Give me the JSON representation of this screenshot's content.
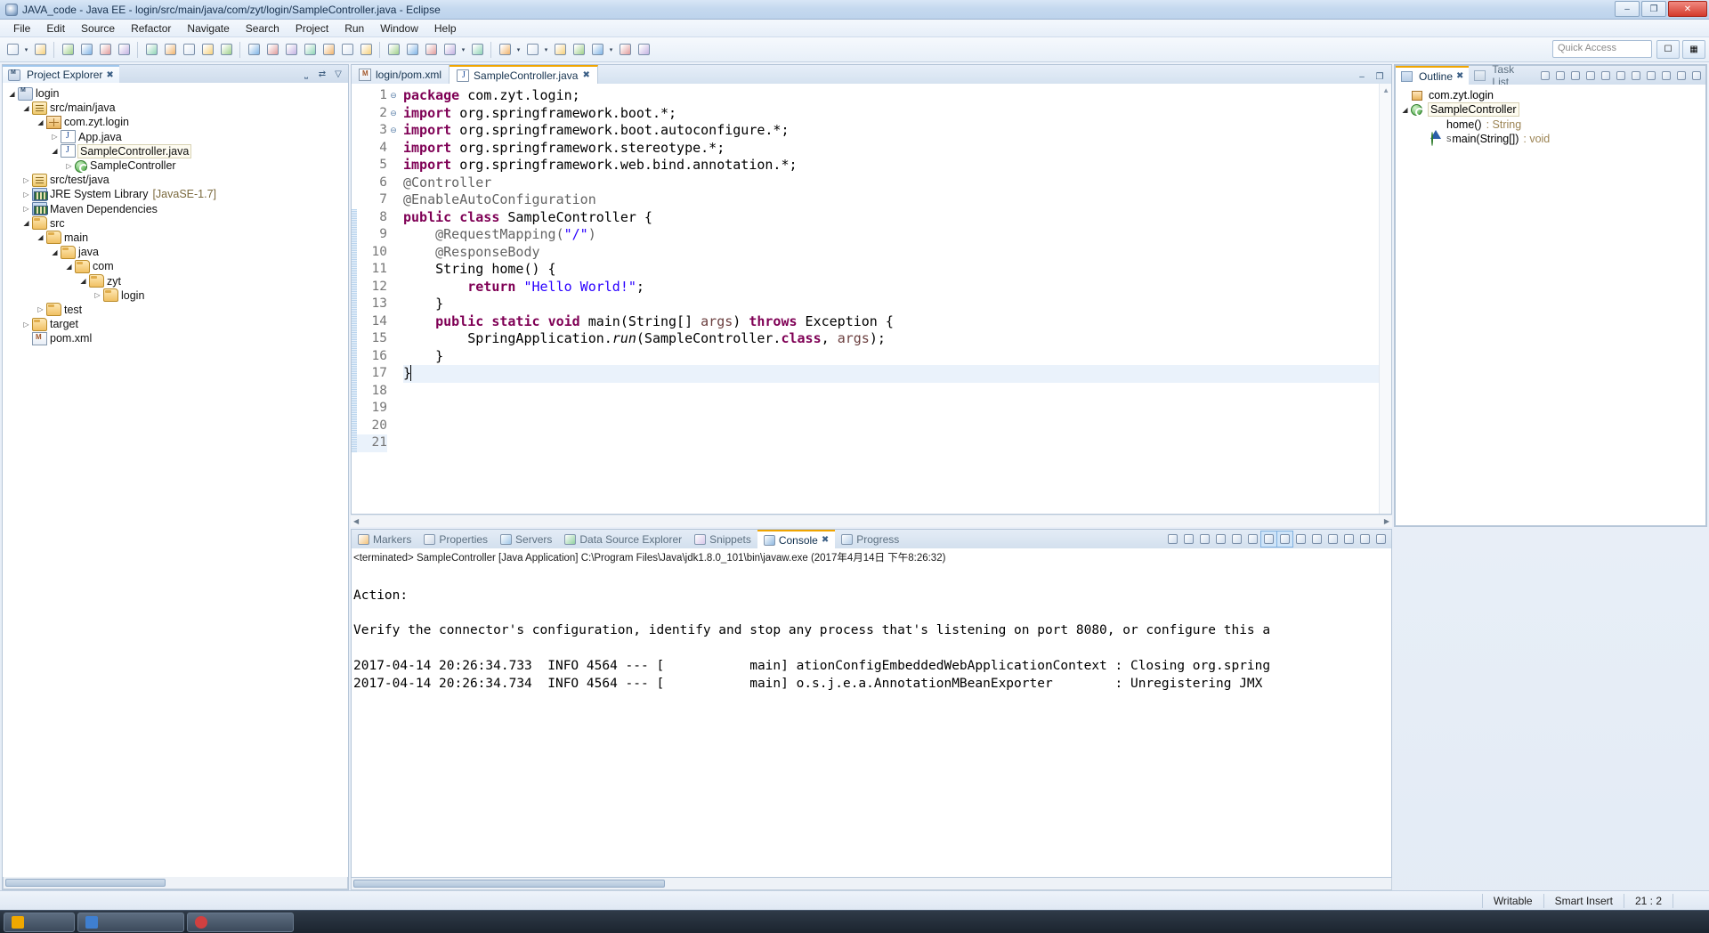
{
  "window": {
    "title": "JAVA_code - Java EE - login/src/main/java/com/zyt/login/SampleController.java - Eclipse",
    "minimize_label": "–",
    "maximize_label": "❐",
    "close_label": "✕"
  },
  "menu": {
    "items": [
      "File",
      "Edit",
      "Source",
      "Refactor",
      "Navigate",
      "Search",
      "Project",
      "Run",
      "Window",
      "Help"
    ]
  },
  "toolbar": {
    "quick_access_placeholder": "Quick Access",
    "icons": [
      {
        "name": "new-wizard-icon",
        "glyph": "὜B"
      },
      {
        "name": "save-icon",
        "glyph": "⬜"
      },
      {
        "name": "save-all-icon",
        "glyph": "❐"
      },
      {
        "name": "print-icon",
        "glyph": "⎙"
      },
      {
        "name": "highlight-icon",
        "glyph": "✎"
      },
      {
        "name": "build-icon",
        "glyph": "⚒"
      },
      {
        "name": "new-java-package-icon",
        "glyph": "⊞"
      },
      {
        "name": "new-java-class-icon",
        "glyph": "▤"
      },
      {
        "name": "new-annotation-icon",
        "glyph": "▥"
      },
      {
        "name": "open-type-icon",
        "glyph": "⌸"
      },
      {
        "name": "skip-breakpoints-icon",
        "glyph": "⊘"
      },
      {
        "name": "resume-icon",
        "glyph": "▷"
      },
      {
        "name": "suspend-icon",
        "glyph": "‖"
      },
      {
        "name": "terminate-icon",
        "glyph": "■"
      },
      {
        "name": "step-into-icon",
        "glyph": "⤵"
      },
      {
        "name": "step-over-icon",
        "glyph": "↷"
      },
      {
        "name": "step-return-icon",
        "glyph": "↶"
      },
      {
        "name": "drop-to-frame-icon",
        "glyph": "⤴"
      },
      {
        "name": "toggle-mark-occurrences-icon",
        "glyph": "☰"
      },
      {
        "name": "search-icon",
        "glyph": "⌕"
      },
      {
        "name": "debug-icon",
        "glyph": "✻"
      },
      {
        "name": "run-icon",
        "glyph": "▶"
      },
      {
        "name": "run-external-tools-icon",
        "glyph": "⚡"
      },
      {
        "name": "new-editor-icon",
        "glyph": "❐"
      },
      {
        "name": "coverage-icon",
        "glyph": "◉"
      },
      {
        "name": "open-task-icon",
        "glyph": "Ὄ2"
      },
      {
        "name": "open-folder-icon",
        "glyph": "Ὄ1"
      },
      {
        "name": "pin-icon",
        "glyph": "✒"
      },
      {
        "name": "web-browser-icon",
        "glyph": "ἱ0"
      },
      {
        "name": "server-icon",
        "glyph": "⚙"
      }
    ],
    "perspective_buttons": [
      {
        "name": "open-perspective-icon",
        "glyph": "⊞"
      },
      {
        "name": "java-ee-perspective-icon",
        "glyph": "☗"
      }
    ]
  },
  "explorer": {
    "title": "Project Explorer",
    "close_label": "✖",
    "tools": [
      {
        "name": "collapse-all-icon",
        "glyph": "⊟"
      },
      {
        "name": "link-with-editor-icon",
        "glyph": "⇄"
      },
      {
        "name": "view-menu-icon",
        "glyph": "▽"
      }
    ],
    "nodes": [
      {
        "label": "login",
        "indent": 0,
        "arrow": "open",
        "icon": "ic-proj",
        "selected": false
      },
      {
        "label": "src/main/java",
        "indent": 1,
        "arrow": "open",
        "icon": "ic-pkgroot",
        "selected": false
      },
      {
        "label": "com.zyt.login",
        "indent": 2,
        "arrow": "open",
        "icon": "ic-pkg",
        "selected": false
      },
      {
        "label": "App.java",
        "indent": 3,
        "arrow": "closed",
        "icon": "ic-java",
        "selected": false
      },
      {
        "label": "SampleController.java",
        "indent": 3,
        "arrow": "open",
        "icon": "ic-java",
        "selected": true
      },
      {
        "label": "SampleController",
        "indent": 4,
        "arrow": "closed",
        "icon": "ic-class",
        "selected": false
      },
      {
        "label": "src/test/java",
        "indent": 1,
        "arrow": "closed",
        "icon": "ic-pkgroot",
        "selected": false
      },
      {
        "label": "JRE System Library",
        "suffix": "[JavaSE-1.7]",
        "indent": 1,
        "arrow": "closed",
        "icon": "ic-lib",
        "selected": false
      },
      {
        "label": "Maven Dependencies",
        "indent": 1,
        "arrow": "closed",
        "icon": "ic-lib",
        "selected": false
      },
      {
        "label": "src",
        "indent": 1,
        "arrow": "open",
        "icon": "ic-folder",
        "selected": false
      },
      {
        "label": "main",
        "indent": 2,
        "arrow": "open",
        "icon": "ic-folder",
        "selected": false
      },
      {
        "label": "java",
        "indent": 3,
        "arrow": "open",
        "icon": "ic-folder",
        "selected": false
      },
      {
        "label": "com",
        "indent": 4,
        "arrow": "open",
        "icon": "ic-folder",
        "selected": false
      },
      {
        "label": "zyt",
        "indent": 5,
        "arrow": "open",
        "icon": "ic-folder",
        "selected": false
      },
      {
        "label": "login",
        "indent": 6,
        "arrow": "closed",
        "icon": "ic-folder",
        "selected": false
      },
      {
        "label": "test",
        "indent": 2,
        "arrow": "closed",
        "icon": "ic-folder",
        "selected": false
      },
      {
        "label": "target",
        "indent": 1,
        "arrow": "closed",
        "icon": "ic-folder",
        "selected": false
      },
      {
        "label": "pom.xml",
        "indent": 1,
        "arrow": "none",
        "icon": "ic-xml",
        "selected": false
      }
    ]
  },
  "editor": {
    "tabs": [
      {
        "label": "login/pom.xml",
        "icon": "maven-file-icon",
        "active": false,
        "closeable": false
      },
      {
        "label": "SampleController.java",
        "icon": "java-file-icon",
        "active": true,
        "closeable": true,
        "close_label": "✖"
      }
    ],
    "minimize_label": "–",
    "maximize_label": "❐",
    "lines": [
      {
        "n": 1,
        "fold": "",
        "html": "<span class=\"kw\">package</span> com.zyt.login;"
      },
      {
        "n": 2,
        "fold": "",
        "html": ""
      },
      {
        "n": 3,
        "fold": "⊖",
        "html": "<span class=\"kw\">import</span> org.springframework.boot.*;"
      },
      {
        "n": 4,
        "fold": "",
        "html": "<span class=\"kw\">import</span> org.springframework.boot.autoconfigure.*;"
      },
      {
        "n": 5,
        "fold": "",
        "html": "<span class=\"kw\">import</span> org.springframework.stereotype.*;"
      },
      {
        "n": 6,
        "fold": "",
        "html": "<span class=\"kw\">import</span> org.springframework.web.bind.annotation.*;"
      },
      {
        "n": 7,
        "fold": "",
        "html": ""
      },
      {
        "n": 8,
        "fold": "",
        "html": "<span class=\"ann\">@Controller</span>"
      },
      {
        "n": 9,
        "fold": "",
        "html": "<span class=\"ann\">@EnableAutoConfiguration</span>"
      },
      {
        "n": 10,
        "fold": "",
        "html": "<span class=\"kw\">public</span> <span class=\"kw\">class</span> SampleController {"
      },
      {
        "n": 11,
        "fold": "",
        "html": ""
      },
      {
        "n": 12,
        "fold": "⊖",
        "html": "    <span class=\"ann\">@RequestMapping(</span><span class=\"str\">\"/\"</span><span class=\"ann\">)</span>"
      },
      {
        "n": 13,
        "fold": "",
        "html": "    <span class=\"ann\">@ResponseBody</span>"
      },
      {
        "n": 14,
        "fold": "",
        "html": "    String home() {"
      },
      {
        "n": 15,
        "fold": "",
        "html": "        <span class=\"kw\">return</span> <span class=\"str\">\"Hello World!\"</span>;"
      },
      {
        "n": 16,
        "fold": "",
        "html": "    }"
      },
      {
        "n": 17,
        "fold": "",
        "html": ""
      },
      {
        "n": 18,
        "fold": "⊖",
        "html": "    <span class=\"kw\">public</span> <span class=\"kw\">static</span> <span class=\"kw\">void</span> main(String[] <span class=\"param\">args</span>) <span class=\"kw\">throws</span> Exception {"
      },
      {
        "n": 19,
        "fold": "",
        "html": "        SpringApplication.<span class=\"static-it\">run</span>(SampleController.<span class=\"kw\">class</span>, <span class=\"param\">args</span>);"
      },
      {
        "n": 20,
        "fold": "",
        "html": "    }"
      },
      {
        "n": 21,
        "fold": "",
        "html": "}",
        "highlight": true,
        "caret": true
      }
    ]
  },
  "console": {
    "tabs": [
      {
        "label": "Markers",
        "icon": "markers-icon",
        "active": false
      },
      {
        "label": "Properties",
        "icon": "properties-icon",
        "active": false
      },
      {
        "label": "Servers",
        "icon": "servers-icon",
        "active": false
      },
      {
        "label": "Data Source Explorer",
        "icon": "data-source-icon",
        "active": false
      },
      {
        "label": "Snippets",
        "icon": "snippets-icon",
        "active": false
      },
      {
        "label": "Console",
        "icon": "console-icon",
        "active": true,
        "close_label": "✖"
      },
      {
        "label": "Progress",
        "icon": "progress-icon",
        "active": false
      }
    ],
    "tools": [
      {
        "name": "terminate-icon",
        "glyph": "■"
      },
      {
        "name": "remove-launch-icon",
        "glyph": "✖"
      },
      {
        "name": "remove-all-launches-icon",
        "glyph": "✖"
      },
      {
        "name": "clear-console-icon",
        "glyph": "Ὕ1"
      },
      {
        "name": "scroll-lock-icon",
        "glyph": "↧"
      },
      {
        "name": "word-wrap-icon",
        "glyph": "↵"
      },
      {
        "name": "pin-console-icon",
        "glyph": "ὌC",
        "on": true
      },
      {
        "name": "display-selected-console-icon",
        "glyph": "▣",
        "on": true
      },
      {
        "name": "open-console-icon",
        "glyph": "Ὓ5"
      },
      {
        "name": "console-dropdown-icon",
        "glyph": "▾"
      },
      {
        "name": "new-console-view-icon",
        "glyph": "὜B"
      },
      {
        "name": "console-menu-icon",
        "glyph": "▾"
      },
      {
        "name": "minimize-icon",
        "glyph": "–"
      },
      {
        "name": "maximize-icon",
        "glyph": "❐"
      }
    ],
    "launch_header": "<terminated> SampleController [Java Application] C:\\Program Files\\Java\\jdk1.8.0_101\\bin\\javaw.exe (2017年4月14日 下午8:26:32)",
    "output_lines": [
      "",
      "Action:",
      "",
      "Verify the connector's configuration, identify and stop any process that's listening on port 8080, or configure this a",
      "",
      "2017-04-14 20:26:34.733  INFO 4564 --- [           main] ationConfigEmbeddedWebApplicationContext : Closing org.spring",
      "2017-04-14 20:26:34.734  INFO 4564 --- [           main] o.s.j.e.a.AnnotationMBeanExporter        : Unregistering JMX"
    ]
  },
  "outline": {
    "tabs": [
      {
        "label": "Outline",
        "icon": "outline-icon",
        "active": true,
        "close_label": "✖"
      },
      {
        "label": "Task List",
        "icon": "task-list-icon",
        "active": false
      }
    ],
    "tools": [
      {
        "name": "focus-on-active-task-icon",
        "glyph": "●"
      },
      {
        "name": "categorize-icon",
        "glyph": "▤"
      },
      {
        "name": "sort-icon",
        "glyph": "↓z"
      },
      {
        "name": "find-icon",
        "glyph": "⌕"
      },
      {
        "name": "filter-icon",
        "glyph": "⌕"
      },
      {
        "name": "hide-fields-icon",
        "glyph": "◆"
      },
      {
        "name": "hide-static-icon",
        "glyph": "●"
      },
      {
        "name": "hide-nonpublic-icon",
        "glyph": "○"
      },
      {
        "name": "view-menu-icon",
        "glyph": "▽"
      },
      {
        "name": "minimize-icon",
        "glyph": "–"
      },
      {
        "name": "maximize-icon",
        "glyph": "❐"
      }
    ],
    "nodes": [
      {
        "label": "com.zyt.login",
        "indent": 0,
        "arrow": "none",
        "icon": "package",
        "type": "",
        "selected": false,
        "static": false
      },
      {
        "label": "SampleController",
        "indent": 0,
        "arrow": "open",
        "icon": "class",
        "type": "",
        "selected": true,
        "static": false
      },
      {
        "label": "home()",
        "indent": 1,
        "arrow": "none",
        "icon": "method-default",
        "type": ": String",
        "selected": false,
        "static": false
      },
      {
        "label": "main(String[])",
        "indent": 1,
        "arrow": "none",
        "icon": "method-public",
        "type": ": void",
        "selected": false,
        "static": true,
        "static_marker": "S"
      }
    ]
  },
  "statusbar": {
    "writable": "Writable",
    "insert_mode": "Smart Insert",
    "cursor_position": "21 : 2",
    "extra": ""
  },
  "taskbar": {
    "items": [
      {
        "name": "taskbar-item-1",
        "color": "#f0a800"
      },
      {
        "name": "taskbar-item-2",
        "color": "#3f7fd0"
      },
      {
        "name": "taskbar-item-3",
        "color": "#d04040"
      }
    ]
  },
  "colors": {
    "accent": "#f0a500",
    "keyword": "#7f0055",
    "string": "#2a00ff",
    "annotation": "#646464",
    "selection": "#eaf2fb"
  }
}
